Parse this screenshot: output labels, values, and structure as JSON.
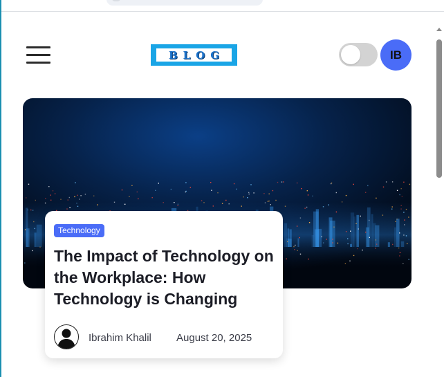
{
  "header": {
    "logo_text": "BLOG",
    "user_initials": "IB",
    "menu_icon": "hamburger-menu-icon",
    "theme_toggle": {
      "state": "off"
    }
  },
  "featured_post": {
    "category": "Technology",
    "title": "The Impact of Technology on the Workplace: How Technology is Changing",
    "author": "Ibrahim Khalil",
    "date": "August 20, 2025",
    "author_icon": "user-silhouette-icon"
  },
  "colors": {
    "accent": "#4a6cf7",
    "logo_bg": "#1aa5e6",
    "toggle_off": "#d3d3d3",
    "title_text": "#1c1d26"
  }
}
